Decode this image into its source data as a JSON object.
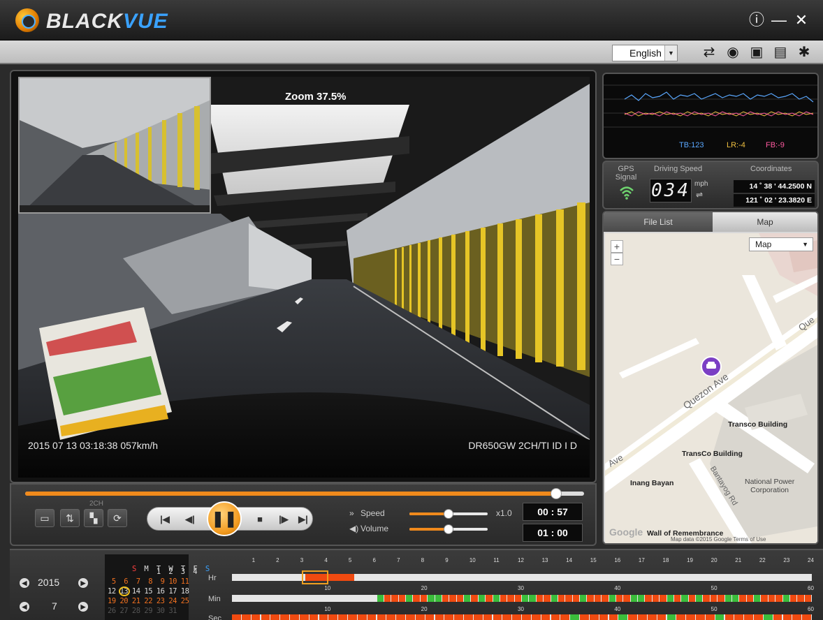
{
  "app": {
    "brand_black": "BLACK",
    "brand_vue": "VUE"
  },
  "window": {
    "info_icon": "ⓘ",
    "minimize_icon": "—",
    "close_icon": "✕"
  },
  "toolbar": {
    "language": "English",
    "icons": [
      "convert-icon",
      "gps-icon",
      "camera-icon",
      "print-icon",
      "settings-icon"
    ]
  },
  "video": {
    "zoom_label": "Zoom 37.5%",
    "osd_timestamp": "2015 07 13  03:18:38     057km/h",
    "osd_model": "DR650GW 2CH/TI ID I D"
  },
  "controls": {
    "channel_label": "2CH",
    "speed_label": "Speed",
    "volume_label": "Volume",
    "speed_value": "x1.0",
    "elapsed": "00 : 57",
    "total": "01 : 00",
    "progress_fraction": 0.95,
    "speed_fraction": 0.5,
    "volume_fraction": 0.5
  },
  "graph": {
    "tb": "TB:123",
    "lr": "LR:-4",
    "fb": "FB:-9"
  },
  "gps": {
    "signal_label": "GPS\nSignal",
    "speed_title": "Driving Speed",
    "speed_value": "034",
    "speed_unit": "mph",
    "coord_title": "Coordinates",
    "lat": "14 ˚  38 ' 44.2500 N",
    "lon": "121 ˚  02 ' 23.3820 E"
  },
  "map": {
    "tab_filelist": "File List",
    "tab_map": "Map",
    "map_type": "Map",
    "zoom_in": "+",
    "zoom_out": "−",
    "labels": {
      "quezon": "Quezon Ave",
      "que": "Que",
      "transco_building": "Transco Building",
      "transco_building2": "TransCo Building",
      "inang_bayan": "Inang Bayan",
      "ave": "Ave",
      "bantayog": "Bantayog Rd",
      "national_power": "National Power\nCorporation",
      "wall": "Wall of Remembrance",
      "google": "Google",
      "map_data": "Map data ©2015 Google   Terms of Use"
    }
  },
  "calendar": {
    "year": "2015",
    "month": "7",
    "weekdays": [
      "S",
      "M",
      "T",
      "W",
      "T",
      "F",
      "S"
    ],
    "rows": [
      "            1  2  3  4",
      " 5  6  7  8  9 10 11",
      "12 13 14 15 16 17 18",
      "19 20 21 22 23 24 25",
      "26 27 28 29 30 31"
    ],
    "selected_day": "13"
  },
  "timeline": {
    "hr_label": "Hr",
    "min_label": "Min",
    "sec_label": "Sec",
    "hr_ticks": [
      "1",
      "2",
      "3",
      "4",
      "5",
      "6",
      "7",
      "8",
      "9",
      "10",
      "11",
      "12",
      "13",
      "14",
      "15",
      "16",
      "17",
      "18",
      "19",
      "20",
      "21",
      "22",
      "23",
      "24"
    ],
    "min_ticks": [
      "10",
      "20",
      "30",
      "40",
      "50",
      "60"
    ],
    "sec_ticks": [
      "10",
      "20",
      "30",
      "40",
      "50",
      "60"
    ]
  },
  "colors": {
    "accent": "#f08a1c",
    "brand_blue": "#3aa2ff",
    "tb_color": "#5aa8ff",
    "lr_color": "#f0c040",
    "fb_color": "#ff5aa0",
    "timeline_green": "#3bbd3b"
  }
}
